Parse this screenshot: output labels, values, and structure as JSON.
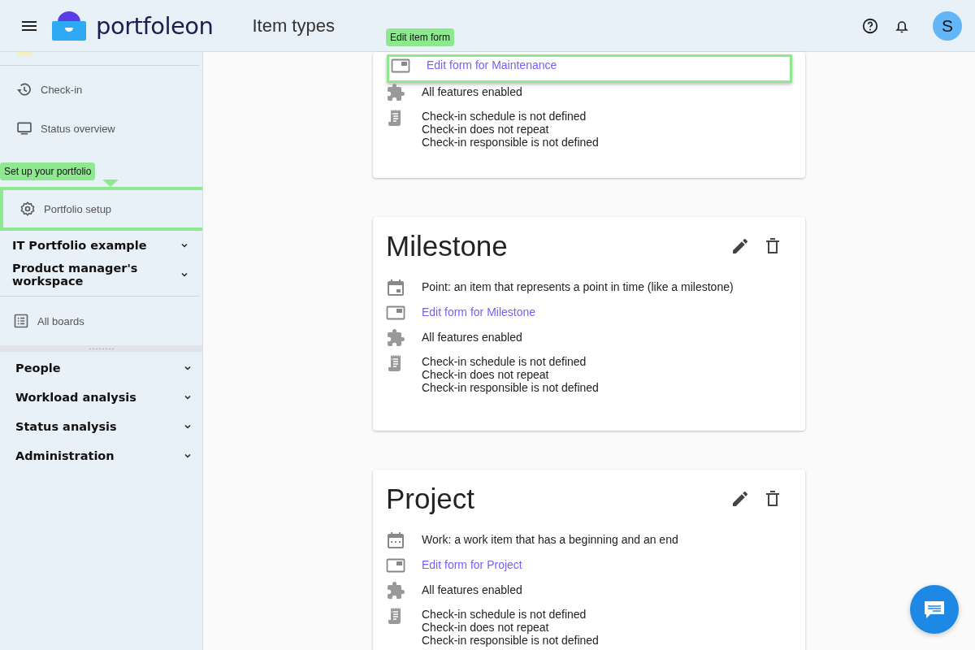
{
  "header": {
    "logo_text": "portfoleon",
    "page_title": "Item types",
    "avatar": "S"
  },
  "sidebar": {
    "nav_items": [
      {
        "label": "Check-in",
        "highlighted": false
      },
      {
        "label": "Status overview",
        "highlighted": false
      },
      {
        "label": "Portfolio setup",
        "highlighted": true,
        "tooltip": "Set up your portfolio"
      }
    ],
    "workspaces": [
      {
        "label": "IT Portfolio example",
        "expanded": false
      },
      {
        "label": "Product manager's workspace",
        "expanded": false
      }
    ],
    "boards_link": "All boards",
    "sections": [
      {
        "label": "People",
        "expanded": false
      },
      {
        "label": "Workload analysis",
        "expanded": false
      },
      {
        "label": "Status analysis",
        "expanded": false
      },
      {
        "label": "Administration",
        "expanded": false
      }
    ]
  },
  "cards": [
    {
      "rows": [
        {
          "kind": "form",
          "text": "Edit form for Maintenance",
          "highlighted": true,
          "tooltip": "Edit item form"
        },
        {
          "kind": "features",
          "text": "All features enabled"
        },
        {
          "kind": "checkin",
          "lines": [
            "Check-in schedule is not defined",
            "Check-in does not repeat",
            "Check-in responsible is not defined"
          ]
        }
      ]
    },
    {
      "title": "Milestone",
      "rows": [
        {
          "kind": "point",
          "text": "Point: an item that represents a point in time (like a milestone)"
        },
        {
          "kind": "form",
          "text": "Edit form for Milestone",
          "highlighted": false
        },
        {
          "kind": "features",
          "text": "All features enabled"
        },
        {
          "kind": "checkin",
          "lines": [
            "Check-in schedule is not defined",
            "Check-in does not repeat",
            "Check-in responsible is not defined"
          ]
        }
      ]
    },
    {
      "title": "Project",
      "rows": [
        {
          "kind": "work",
          "text": "Work: a work item that has a beginning and an end"
        },
        {
          "kind": "form",
          "text": "Edit form for Project",
          "highlighted": false
        },
        {
          "kind": "features",
          "text": "All features enabled"
        },
        {
          "kind": "checkin",
          "lines": [
            "Check-in schedule is not defined",
            "Check-in does not repeat",
            "Check-in responsible is not defined"
          ]
        }
      ]
    }
  ]
}
